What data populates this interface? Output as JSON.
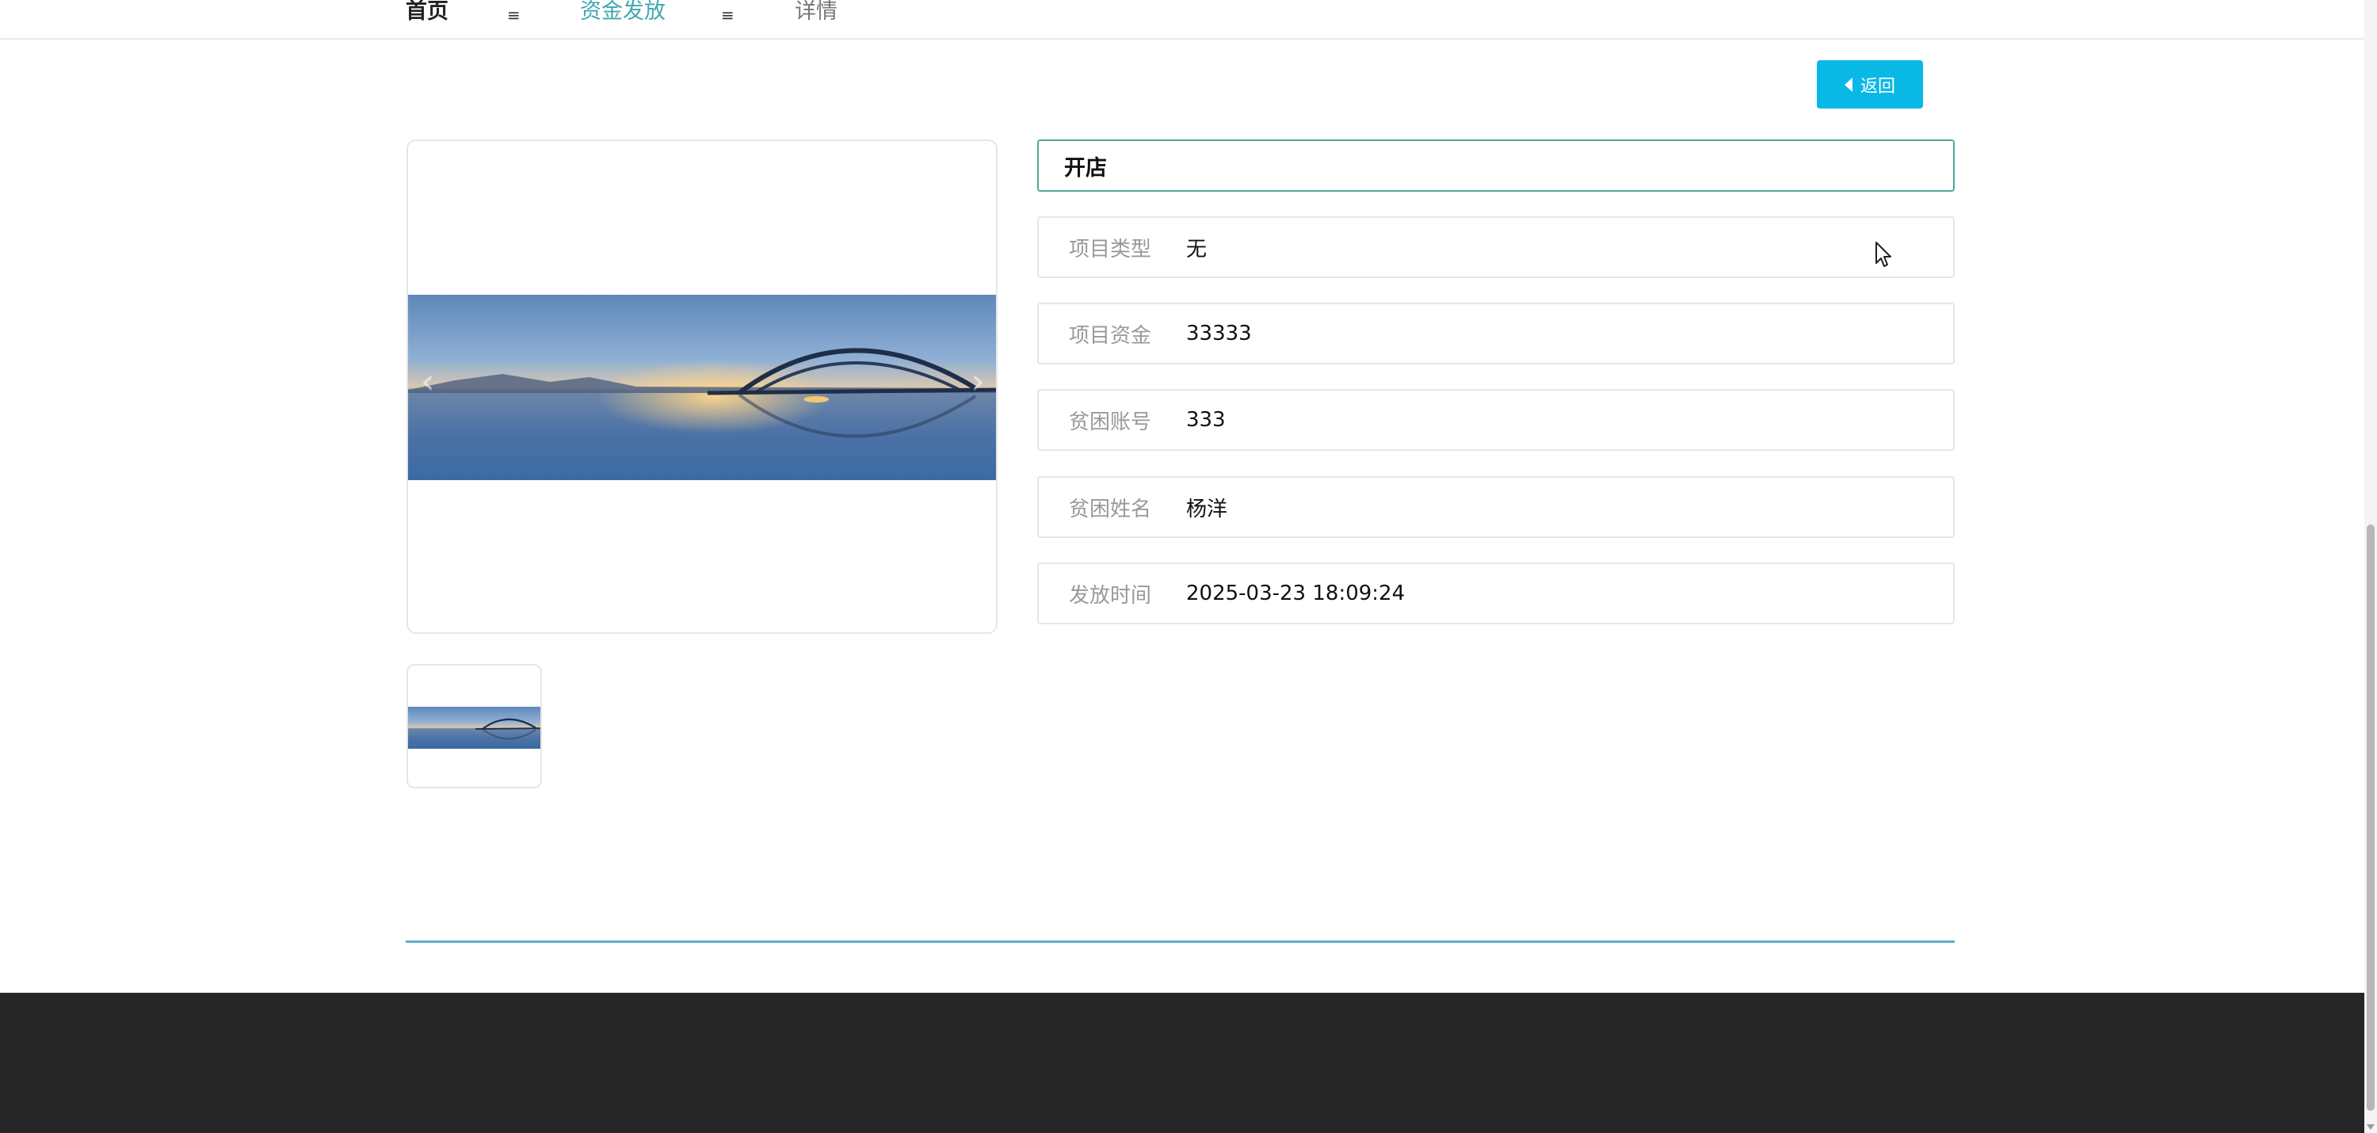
{
  "breadcrumb": {
    "home": "首页",
    "separator": "≡",
    "section": "资金发放",
    "current": "详情"
  },
  "back_button": {
    "label": "返回"
  },
  "gallery": {
    "prev_icon": "‹",
    "next_icon": "›"
  },
  "detail": {
    "title": "开店",
    "fields": [
      {
        "label": "项目类型",
        "value": "无"
      },
      {
        "label": "项目资金",
        "value": "33333"
      },
      {
        "label": "贫困账号",
        "value": "333"
      },
      {
        "label": "贫困姓名",
        "value": "杨洋"
      },
      {
        "label": "发放时间",
        "value": "2025-03-23 18:09:24"
      }
    ]
  },
  "colors": {
    "accent": "#0ab8e6",
    "breadcrumb_active": "#3fa7b0",
    "title_border": "#4fa79a",
    "divider": "#59aecb",
    "footer": "#262626"
  }
}
